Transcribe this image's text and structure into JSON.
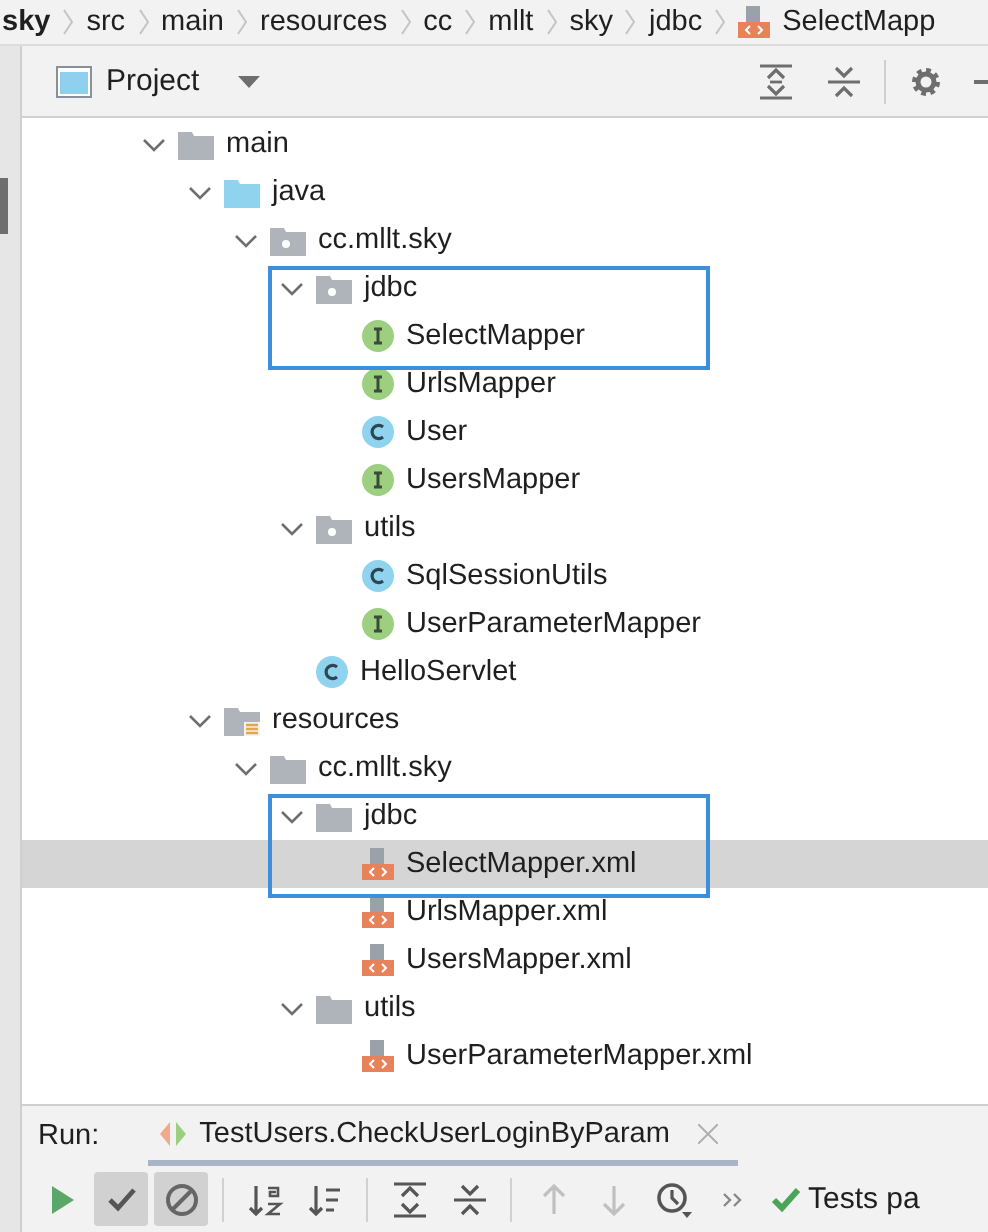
{
  "breadcrumb": {
    "items": [
      {
        "label": "sky",
        "kind": "bold"
      },
      {
        "label": "src",
        "kind": "plain"
      },
      {
        "label": "main",
        "kind": "plain"
      },
      {
        "label": "resources",
        "kind": "plain"
      },
      {
        "label": "cc",
        "kind": "plain"
      },
      {
        "label": "mllt",
        "kind": "plain"
      },
      {
        "label": "sky",
        "kind": "plain"
      },
      {
        "label": "jdbc",
        "kind": "plain"
      },
      {
        "label": "SelectMapp",
        "kind": "xml"
      }
    ]
  },
  "toolbar": {
    "title": "Project"
  },
  "tree": [
    {
      "label": "main",
      "kind": "folder",
      "expanded": true,
      "children": [
        {
          "label": "java",
          "kind": "source",
          "expanded": true,
          "children": [
            {
              "label": "cc.mllt.sky",
              "kind": "package",
              "expanded": true,
              "children": [
                {
                  "label": "jdbc",
                  "kind": "package",
                  "expanded": true,
                  "outlined": true,
                  "children": [
                    {
                      "label": "SelectMapper",
                      "kind": "interface",
                      "selected": false
                    },
                    {
                      "label": "UrlsMapper",
                      "kind": "interface",
                      "selected": false
                    },
                    {
                      "label": "User",
                      "kind": "class",
                      "selected": false
                    },
                    {
                      "label": "UsersMapper",
                      "kind": "interface",
                      "selected": false
                    }
                  ]
                },
                {
                  "label": "utils",
                  "kind": "package",
                  "expanded": true,
                  "outlined": false,
                  "children": [
                    {
                      "label": "SqlSessionUtils",
                      "kind": "class",
                      "selected": false
                    },
                    {
                      "label": "UserParameterMapper",
                      "kind": "interface",
                      "selected": false
                    }
                  ]
                },
                {
                  "label": "HelloServlet",
                  "kind": "class",
                  "selected": false
                }
              ]
            }
          ]
        },
        {
          "label": "resources",
          "kind": "resources",
          "expanded": true,
          "children": [
            {
              "label": "cc.mllt.sky",
              "kind": "folder",
              "expanded": true,
              "children": [
                {
                  "label": "jdbc",
                  "kind": "folder",
                  "expanded": true,
                  "outlined": true,
                  "children": [
                    {
                      "label": "SelectMapper.xml",
                      "kind": "xml",
                      "selected": true
                    },
                    {
                      "label": "UrlsMapper.xml",
                      "kind": "xml",
                      "selected": false
                    },
                    {
                      "label": "UsersMapper.xml",
                      "kind": "xml",
                      "selected": false
                    }
                  ]
                },
                {
                  "label": "utils",
                  "kind": "folder",
                  "expanded": true,
                  "outlined": false,
                  "children": [
                    {
                      "label": "UserParameterMapper.xml",
                      "kind": "xml",
                      "selected": false
                    }
                  ]
                }
              ]
            }
          ]
        }
      ]
    }
  ],
  "run": {
    "label": "Run:",
    "tab": "TestUsers.CheckUserLoginByParam",
    "buttons": [
      {
        "kind": "play",
        "on": false,
        "disabled": false
      },
      {
        "kind": "check",
        "on": true,
        "disabled": false
      },
      {
        "kind": "stop",
        "on": true,
        "disabled": false
      },
      {
        "kind": "sep"
      },
      {
        "kind": "sort-alpha",
        "on": false,
        "disabled": false
      },
      {
        "kind": "sort-duration",
        "on": false,
        "disabled": false
      },
      {
        "kind": "sep"
      },
      {
        "kind": "expand",
        "on": false,
        "disabled": false
      },
      {
        "kind": "collapse",
        "on": false,
        "disabled": false
      },
      {
        "kind": "sep"
      },
      {
        "kind": "up",
        "on": false,
        "disabled": true
      },
      {
        "kind": "down",
        "on": false,
        "disabled": true
      },
      {
        "kind": "clock",
        "on": false,
        "disabled": false
      },
      {
        "kind": "more",
        "on": false,
        "disabled": false
      }
    ],
    "status": "Tests pa"
  }
}
